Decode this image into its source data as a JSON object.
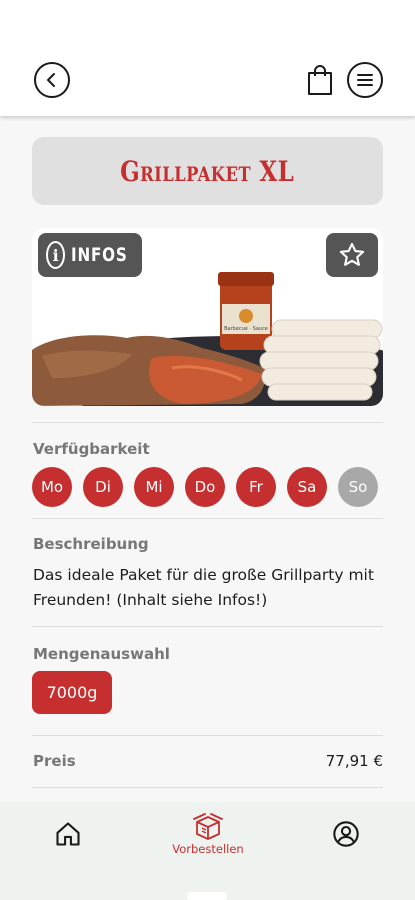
{
  "product": {
    "title": "Grillpaket XL",
    "infos_label": "INFOS",
    "jar_label": "Barbecue · Sauce"
  },
  "availability": {
    "label": "Verfügbarkeit",
    "days": [
      {
        "label": "Mo",
        "available": true
      },
      {
        "label": "Di",
        "available": true
      },
      {
        "label": "Mi",
        "available": true
      },
      {
        "label": "Do",
        "available": true
      },
      {
        "label": "Fr",
        "available": true
      },
      {
        "label": "Sa",
        "available": true
      },
      {
        "label": "So",
        "available": false
      }
    ]
  },
  "description": {
    "label": "Beschreibung",
    "text": "Das ideale Paket für die große Grillparty mit Freunden! (Inhalt siehe Infos!)"
  },
  "quantity": {
    "label": "Mengenauswahl",
    "selected": "7000g"
  },
  "price": {
    "label": "Preis",
    "value": "77,91 €"
  },
  "nav": {
    "home": "home-icon",
    "order_label": "Vorbestellen",
    "profile": "profile-icon"
  },
  "colors": {
    "accent": "#c62f2f",
    "unavailable": "#a8a8a8",
    "badge_bg": "#555555"
  }
}
